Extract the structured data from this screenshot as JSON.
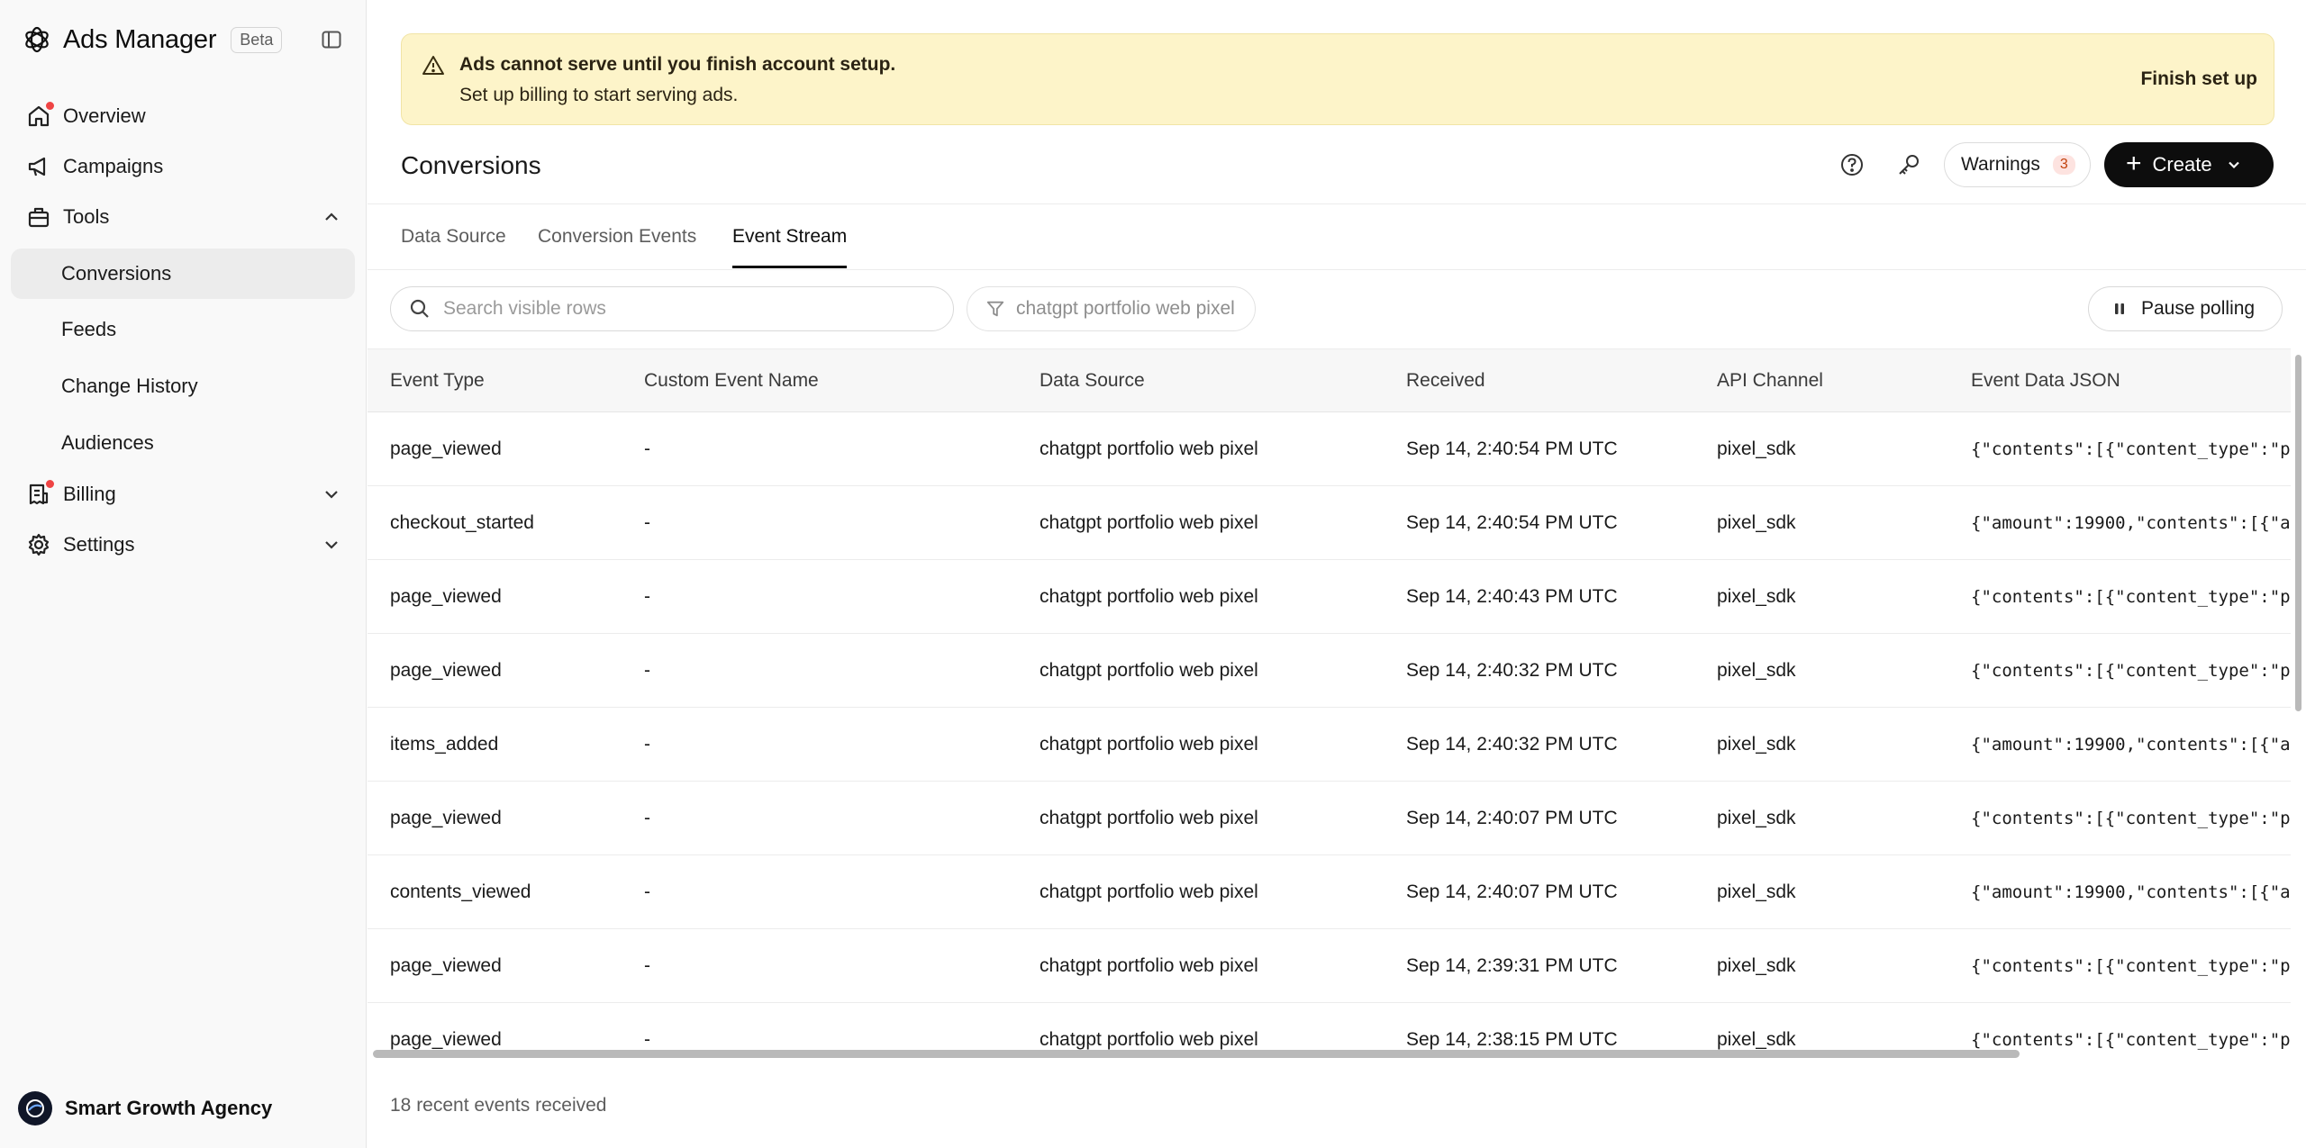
{
  "app": {
    "name": "Ads Manager",
    "badge": "Beta"
  },
  "sidebar": {
    "nav": [
      {
        "label": "Overview",
        "icon": "home-icon",
        "notification_dot": true
      },
      {
        "label": "Campaigns",
        "icon": "megaphone-icon",
        "notification_dot": false
      },
      {
        "label": "Tools",
        "icon": "toolbox-icon",
        "expanded": true
      }
    ],
    "tools_items": [
      {
        "label": "Conversions",
        "active": true
      },
      {
        "label": "Feeds",
        "active": false
      },
      {
        "label": "Change History",
        "active": false
      },
      {
        "label": "Audiences",
        "active": false
      }
    ],
    "billing": {
      "label": "Billing",
      "icon": "receipt-icon",
      "notification_dot": true,
      "expanded": false
    },
    "settings": {
      "label": "Settings",
      "icon": "gear-icon",
      "expanded": false
    },
    "org_name": "Smart Growth Agency"
  },
  "banner": {
    "title": "Ads cannot serve until you finish account setup.",
    "text": "Set up billing to start serving ads.",
    "action": "Finish set up",
    "color": "#fdf4c9"
  },
  "header": {
    "title": "Conversions",
    "warnings_label": "Warnings",
    "warnings_count": "3",
    "create_label": "Create"
  },
  "tabs": [
    {
      "label": "Data Source",
      "active": false
    },
    {
      "label": "Conversion Events",
      "active": false
    },
    {
      "label": "Event Stream",
      "active": true
    }
  ],
  "toolbar": {
    "search_placeholder": "Search visible rows",
    "filter_label": "chatgpt portfolio web pixel",
    "pause_label": "Pause polling"
  },
  "table": {
    "columns": [
      "Event Type",
      "Custom Event Name",
      "Data Source",
      "Received",
      "API Channel",
      "Event Data JSON"
    ],
    "rows": [
      [
        "page_viewed",
        "-",
        "chatgpt portfolio web pixel",
        "Sep 14, 2:40:54 PM UTC",
        "pixel_sdk",
        "{\"contents\":[{\"content_type\":\"p"
      ],
      [
        "checkout_started",
        "-",
        "chatgpt portfolio web pixel",
        "Sep 14, 2:40:54 PM UTC",
        "pixel_sdk",
        "{\"amount\":19900,\"contents\":[{\"a"
      ],
      [
        "page_viewed",
        "-",
        "chatgpt portfolio web pixel",
        "Sep 14, 2:40:43 PM UTC",
        "pixel_sdk",
        "{\"contents\":[{\"content_type\":\"p"
      ],
      [
        "page_viewed",
        "-",
        "chatgpt portfolio web pixel",
        "Sep 14, 2:40:32 PM UTC",
        "pixel_sdk",
        "{\"contents\":[{\"content_type\":\"p"
      ],
      [
        "items_added",
        "-",
        "chatgpt portfolio web pixel",
        "Sep 14, 2:40:32 PM UTC",
        "pixel_sdk",
        "{\"amount\":19900,\"contents\":[{\"a"
      ],
      [
        "page_viewed",
        "-",
        "chatgpt portfolio web pixel",
        "Sep 14, 2:40:07 PM UTC",
        "pixel_sdk",
        "{\"contents\":[{\"content_type\":\"p"
      ],
      [
        "contents_viewed",
        "-",
        "chatgpt portfolio web pixel",
        "Sep 14, 2:40:07 PM UTC",
        "pixel_sdk",
        "{\"amount\":19900,\"contents\":[{\"a"
      ],
      [
        "page_viewed",
        "-",
        "chatgpt portfolio web pixel",
        "Sep 14, 2:39:31 PM UTC",
        "pixel_sdk",
        "{\"contents\":[{\"content_type\":\"p"
      ],
      [
        "page_viewed",
        "-",
        "chatgpt portfolio web pixel",
        "Sep 14, 2:38:15 PM UTC",
        "pixel_sdk",
        "{\"contents\":[{\"content_type\":\"p"
      ]
    ]
  },
  "footer": {
    "status": "18 recent events received"
  }
}
